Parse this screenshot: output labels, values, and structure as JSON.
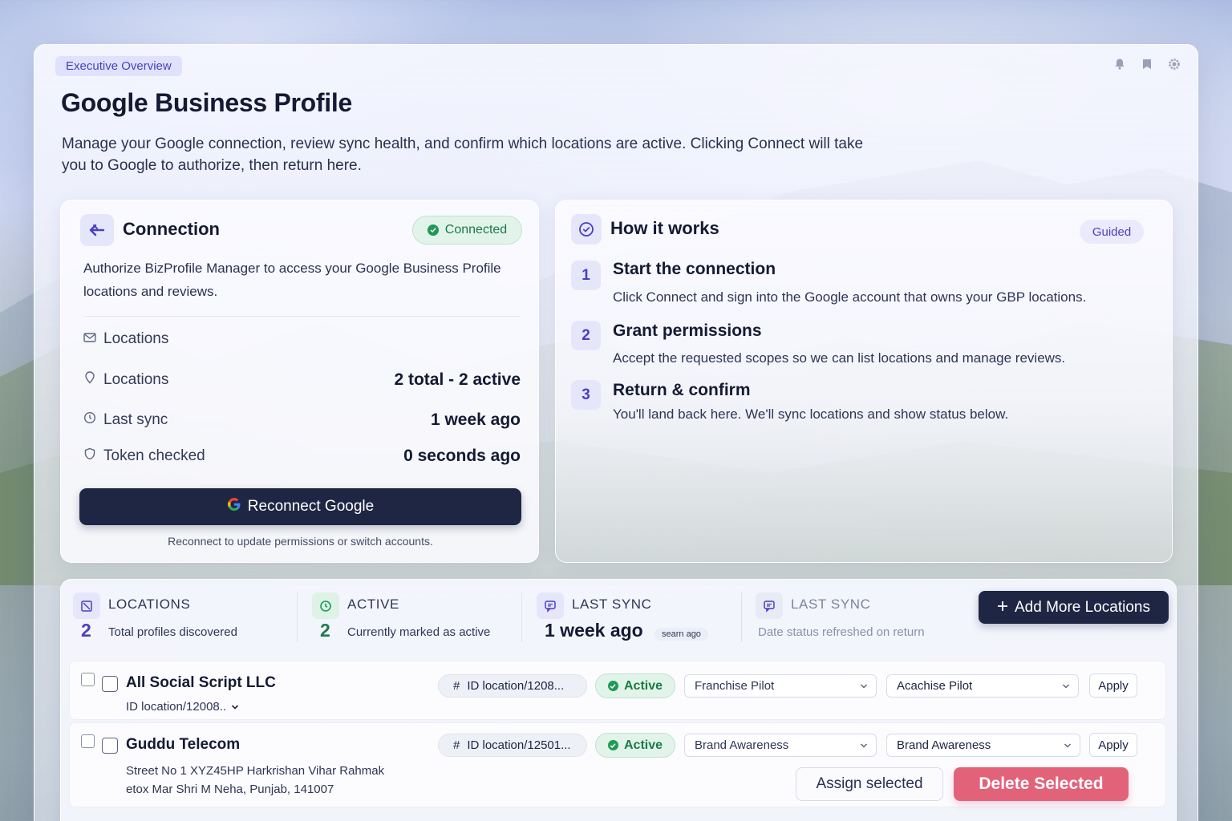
{
  "header": {
    "breadcrumb": "Executive Overview",
    "title": "Google Business Profile",
    "description": "Manage your  Google connection, review sync health, and confirm which locations are active. Clicking Connect will take you to Google to authorize, then return here."
  },
  "connection": {
    "title": "Connection",
    "status": "Connected",
    "description": "Authorize BizProfile Manager to access your Google Business Profile locations and reviews.",
    "rows": [
      {
        "label": "Locations",
        "value": ""
      },
      {
        "label": "Locations",
        "value": "2 total - 2 active"
      },
      {
        "label": "Last sync",
        "value": "1 week ago"
      },
      {
        "label": "Token checked",
        "value": "0 seconds ago"
      }
    ],
    "button": "Reconnect Google",
    "note": "Reconnect to update permissions or switch accounts."
  },
  "how_it_works": {
    "title": "How it works",
    "badge": "Guided",
    "steps": [
      {
        "num": "1",
        "title": "Start the connection",
        "desc": "Click Connect and sign into the Google account that owns your GBP locations."
      },
      {
        "num": "2",
        "title": "Grant permissions",
        "desc": "Accept the requested scopes so we can list locations and manage reviews."
      },
      {
        "num": "3",
        "title": "Return & confirm",
        "desc": "You'll land back here. We'll sync locations and show status below."
      }
    ]
  },
  "stats": [
    {
      "label": "LOCATIONS",
      "number": "2",
      "sub": "Total profiles discovered"
    },
    {
      "label": "ACTIVE",
      "number": "2",
      "sub": "Currently marked as active"
    },
    {
      "label": "LAST SYNC",
      "number": "1  week ago",
      "sub": "searn ago"
    },
    {
      "label": "LAST SYNC",
      "number": "",
      "sub": "Date status refreshed on return"
    }
  ],
  "add_button": "Add More Locations",
  "locations": [
    {
      "name": "All Social Script LLC",
      "sub": "ID location/12008..",
      "id_pill": "ID location/1208...",
      "status": "Active",
      "select1": "Franchise Pilot",
      "select2": "Acachise Pilot",
      "apply": "Apply"
    },
    {
      "name": "Guddu Telecom",
      "address1": "Street No 1 XYZ45HP Harkrishan Vihar Rahmak",
      "address2": "etox Mar Shri M Neha, Punjab, 141007",
      "id_pill": "ID location/12501...",
      "status": "Active",
      "select1": "Brand Awareness",
      "select2": "Brand Awareness",
      "apply": "Apply"
    }
  ],
  "bulk": {
    "assign": "Assign selected",
    "delete": "Delete Selected"
  },
  "icons": {
    "top": [
      "bell-icon",
      "bookmark-icon",
      "gear-icon"
    ],
    "connection": "plug-arrow-icon",
    "how": "check-circle-icon"
  },
  "colors": {
    "accent": "#4a3fc2",
    "dark_button": "#1e2643",
    "success": "#1f9a57",
    "danger": "#e2627a"
  }
}
